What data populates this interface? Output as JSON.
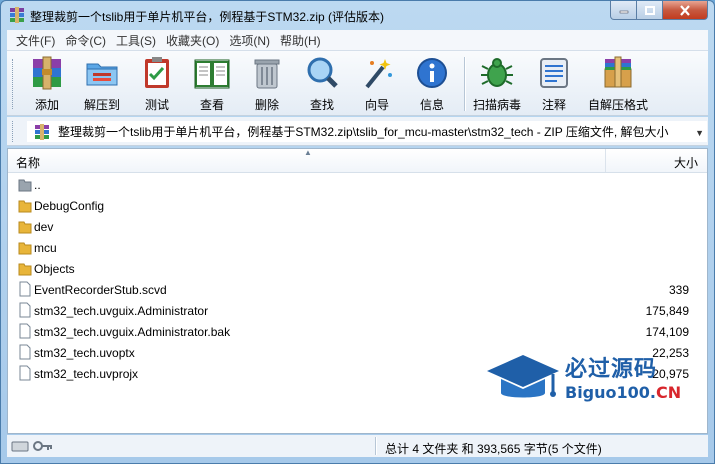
{
  "window": {
    "title": "整理裁剪一个tslib用于单片机平台，例程基于STM32.zip (评估版本)"
  },
  "menu": [
    {
      "label": "文件(F)"
    },
    {
      "label": "命令(C)"
    },
    {
      "label": "工具(S)"
    },
    {
      "label": "收藏夹(O)"
    },
    {
      "label": "选项(N)"
    },
    {
      "label": "帮助(H)"
    }
  ],
  "toolbar": {
    "add": {
      "label": "添加",
      "icon": "archive-add-icon"
    },
    "extract": {
      "label": "解压到",
      "icon": "extract-folder-icon"
    },
    "test": {
      "label": "测试",
      "icon": "test-checklist-icon"
    },
    "view": {
      "label": "查看",
      "icon": "book-view-icon"
    },
    "delete": {
      "label": "删除",
      "icon": "trash-icon"
    },
    "find": {
      "label": "查找",
      "icon": "magnifier-icon"
    },
    "wizard": {
      "label": "向导",
      "icon": "wand-icon"
    },
    "info": {
      "label": "信息",
      "icon": "info-icon"
    },
    "scan": {
      "label": "扫描病毒",
      "icon": "virus-scan-icon"
    },
    "comment": {
      "label": "注释",
      "icon": "comment-icon"
    },
    "sfx": {
      "label": "自解压格式",
      "icon": "sfx-box-icon"
    }
  },
  "address": {
    "path": "整理裁剪一个tslib用于单片机平台，例程基于STM32.zip\\tslib_for_mcu-master\\stm32_tech - ZIP 压缩文件, 解包大小"
  },
  "columns": {
    "name": "名称",
    "size": "大小"
  },
  "files": [
    {
      "name": "..",
      "size": "",
      "type": "parent"
    },
    {
      "name": "DebugConfig",
      "size": "",
      "type": "folder"
    },
    {
      "name": "dev",
      "size": "",
      "type": "folder"
    },
    {
      "name": "mcu",
      "size": "",
      "type": "folder"
    },
    {
      "name": "Objects",
      "size": "",
      "type": "folder"
    },
    {
      "name": "EventRecorderStub.scvd",
      "size": "339",
      "type": "file"
    },
    {
      "name": "stm32_tech.uvguix.Administrator",
      "size": "175,849",
      "type": "file"
    },
    {
      "name": "stm32_tech.uvguix.Administrator.bak",
      "size": "174,109",
      "type": "file"
    },
    {
      "name": "stm32_tech.uvoptx",
      "size": "22,253",
      "type": "file"
    },
    {
      "name": "stm32_tech.uvprojx",
      "size": "20,975",
      "type": "file"
    }
  ],
  "status": {
    "summary": "总计 4 文件夹 和 393,565 字节(5 个文件)"
  },
  "watermark": {
    "cn": "必过源码",
    "en_main": "Biguo100.",
    "en_tail": "CN"
  },
  "colors": {
    "folder": "#e8b53a",
    "titlebar": "#bcd9f1",
    "watermark_blue": "#1f5fa8",
    "watermark_red": "#d8262c"
  }
}
